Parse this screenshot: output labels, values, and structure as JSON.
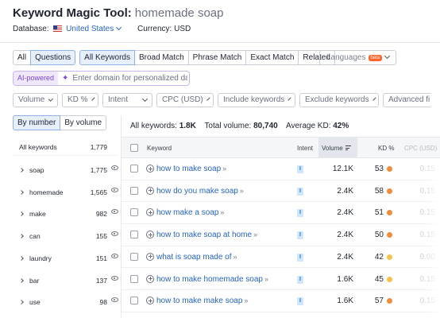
{
  "header": {
    "tool_name": "Keyword Magic Tool:",
    "query": "homemade soap",
    "database_label": "Database:",
    "database_value": "United States",
    "currency_label": "Currency: USD"
  },
  "tabs": {
    "all": "All",
    "questions": "Questions",
    "all_keywords": "All Keywords",
    "broad_match": "Broad Match",
    "phrase_match": "Phrase Match",
    "exact_match": "Exact Match",
    "related": "Related",
    "languages": "Languages",
    "beta": "beta"
  },
  "ai": {
    "label": "AI-powered",
    "placeholder": "Enter domain for personalized data"
  },
  "filters": [
    "Volume",
    "KD %",
    "Intent",
    "CPC (USD)",
    "Include keywords",
    "Exclude keywords",
    "Advanced fi"
  ],
  "sidebar": {
    "by_number": "By number",
    "by_volume": "By volume",
    "all_label": "All keywords",
    "all_count": "1,779",
    "items": [
      {
        "label": "soap",
        "count": "1,775"
      },
      {
        "label": "homemade",
        "count": "1,565"
      },
      {
        "label": "make",
        "count": "982"
      },
      {
        "label": "can",
        "count": "155"
      },
      {
        "label": "laundry",
        "count": "151"
      },
      {
        "label": "bar",
        "count": "137"
      },
      {
        "label": "use",
        "count": "98"
      }
    ]
  },
  "summary": {
    "all_keywords_label": "All keywords:",
    "all_keywords_value": "1.8K",
    "total_volume_label": "Total volume:",
    "total_volume_value": "80,740",
    "avg_kd_label": "Average KD:",
    "avg_kd_value": "42%"
  },
  "table": {
    "headers": {
      "keyword": "Keyword",
      "intent": "Intent",
      "volume": "Volume",
      "kd": "KD %",
      "cpc": "CPC (USD)"
    },
    "rows": [
      {
        "keyword": "how to make soap",
        "intent": "I",
        "volume": "12.1K",
        "kd": "53",
        "kd_color": "#f08c3a",
        "cpc": "0.15"
      },
      {
        "keyword": "how do you make soap",
        "intent": "I",
        "volume": "2.4K",
        "kd": "58",
        "kd_color": "#f08c3a",
        "cpc": "0.15"
      },
      {
        "keyword": "how make a soap",
        "intent": "I",
        "volume": "2.4K",
        "kd": "51",
        "kd_color": "#f08c3a",
        "cpc": "0.15"
      },
      {
        "keyword": "how to make soap at home",
        "intent": "I",
        "volume": "2.4K",
        "kd": "50",
        "kd_color": "#f08c3a",
        "cpc": "0.15"
      },
      {
        "keyword": "what is soap made of",
        "intent": "I",
        "volume": "2.4K",
        "kd": "42",
        "kd_color": "#f5c24a",
        "cpc": "0.00"
      },
      {
        "keyword": "how to make homemade soap",
        "intent": "I",
        "volume": "1.6K",
        "kd": "45",
        "kd_color": "#f5c24a",
        "cpc": "0.15"
      },
      {
        "keyword": "how to make make soap",
        "intent": "I",
        "volume": "1.6K",
        "kd": "57",
        "kd_color": "#f08c3a",
        "cpc": "0.15"
      }
    ]
  }
}
